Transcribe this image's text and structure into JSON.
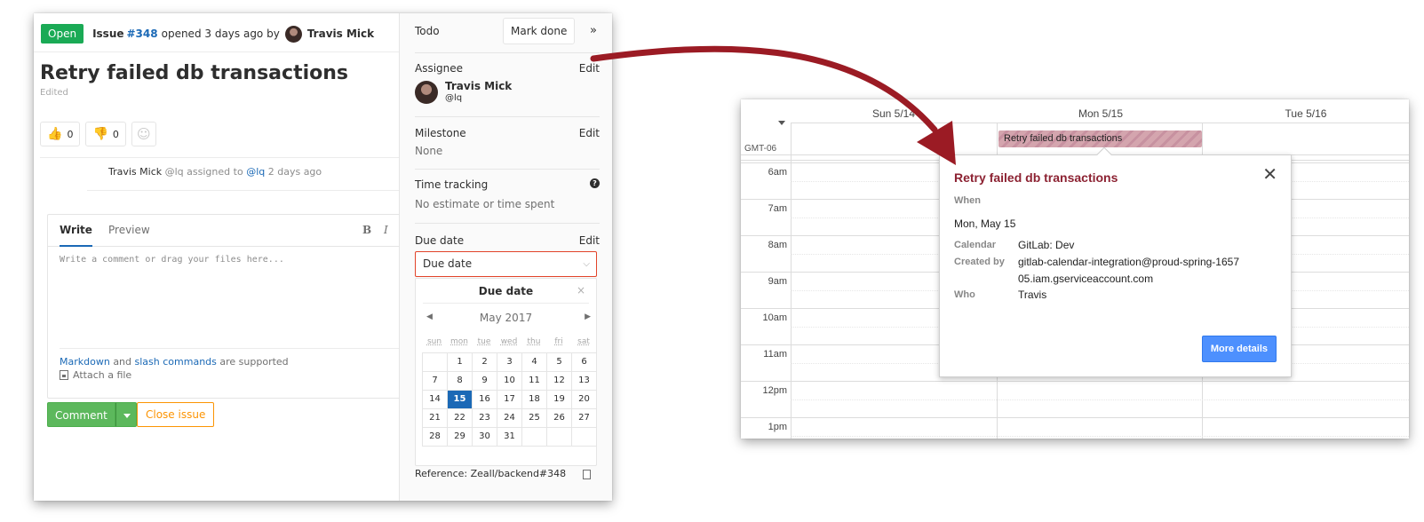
{
  "gitlab": {
    "status_badge": "Open",
    "issue_label": "Issue",
    "issue_number": "#348",
    "opened_text": "opened 3 days ago by",
    "author": "Travis Mick",
    "title": "Retry failed db transactions",
    "edited": "Edited",
    "thumbs_up_count": "0",
    "thumbs_down_count": "0",
    "note": {
      "author": "Travis Mick",
      "handle": "@lq",
      "action": "assigned to",
      "assignee_link": "@lq",
      "time": "2 days ago"
    },
    "editor": {
      "tab_write": "Write",
      "tab_preview": "Preview",
      "bold_tool": "B",
      "italic_tool": "I",
      "placeholder": "Write a comment or drag your files here...",
      "markdown_link": "Markdown",
      "and_text": "and",
      "slash_link": "slash commands",
      "supported_text": "are supported",
      "attach": "Attach a file"
    },
    "comment_button": "Comment",
    "close_button": "Close issue"
  },
  "sidebar": {
    "todo_label": "Todo",
    "mark_done": "Mark done",
    "collapse": "»",
    "assignee_label": "Assignee",
    "edit": "Edit",
    "assignee_name": "Travis Mick",
    "assignee_handle": "@lq",
    "milestone_label": "Milestone",
    "milestone_value": "None",
    "time_tracking_label": "Time tracking",
    "time_tracking_value": "No estimate or time spent",
    "due_date_label": "Due date",
    "due_date_input": "Due date",
    "datepicker": {
      "title": "Due date",
      "close": "×",
      "month": "May",
      "year": "2017",
      "weekdays": [
        "sun",
        "mon",
        "tue",
        "wed",
        "thu",
        "fri",
        "sat"
      ],
      "days": [
        "",
        "1",
        "2",
        "3",
        "4",
        "5",
        "6",
        "7",
        "8",
        "9",
        "10",
        "11",
        "12",
        "13",
        "14",
        "15",
        "16",
        "17",
        "18",
        "19",
        "20",
        "21",
        "22",
        "23",
        "24",
        "25",
        "26",
        "27",
        "28",
        "29",
        "30",
        "31",
        "",
        "",
        ""
      ],
      "selected_day": "15"
    },
    "reference": "Reference: Zeall/backend#348"
  },
  "calendar": {
    "day_headers": [
      "Sun 5/14",
      "Mon 5/15",
      "Tue 5/16"
    ],
    "timezone": "GMT-06",
    "hours": [
      "6am",
      "7am",
      "8am",
      "9am",
      "10am",
      "11am",
      "12pm",
      "1pm"
    ],
    "allday_event": "Retry failed db transactions",
    "popup": {
      "title": "Retry failed db transactions",
      "close": "✕",
      "when_label": "When",
      "when_value": "Mon, May 15",
      "calendar_label": "Calendar",
      "calendar_value": "GitLab: Dev",
      "created_by_label": "Created by",
      "created_by_value": "gitlab-calendar-integration@proud-spring-165705.iam.gserviceaccount.com",
      "who_label": "Who",
      "who_value": "Travis",
      "more_details": "More details"
    }
  },
  "colors": {
    "arrow": "#9b1b24",
    "gitlab_green": "#1aaa55",
    "gitlab_link": "#1b69b6",
    "popup_title": "#8c2232",
    "calendar_button": "#4d90fe"
  }
}
